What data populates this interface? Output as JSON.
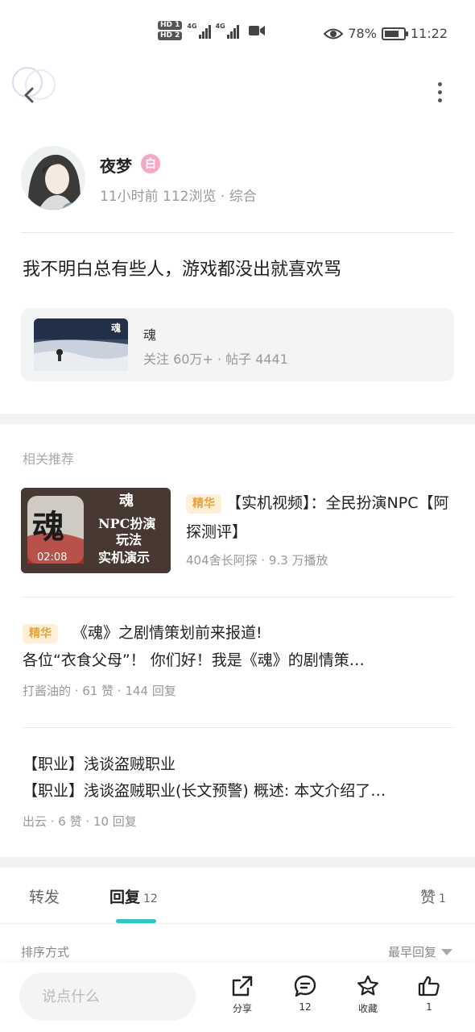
{
  "status_bar": {
    "hd1": "HD 1",
    "hd2": "HD 2",
    "net1": "4G",
    "net2": "4G",
    "battery_pct": "78%",
    "battery_level": 0.78,
    "time": "11:22",
    "icons": [
      "eye-icon",
      "battery-icon",
      "video-camera-icon"
    ]
  },
  "author": {
    "name": "夜梦",
    "level": "白",
    "meta": "11小时前  112浏览 · 综合"
  },
  "post": {
    "text": "我不明白总有些人，游戏都没出就喜欢骂"
  },
  "community": {
    "name": "魂",
    "stats": "关注 60万+ · 帖子 4441",
    "thumb_logo": "魂"
  },
  "related": {
    "title": "相关推荐",
    "items": [
      {
        "tag": "精华",
        "title": "【实机视频】：全民扮演NPC【阿探测评】",
        "meta": "404舍长阿探 · 9.3 万播放",
        "duration": "02:08",
        "thumb_big": "魂",
        "thumb_small": "魂",
        "thumb_line1": "NPC扮演",
        "thumb_line2": "玩法",
        "thumb_line3": "实机演示"
      },
      {
        "tag": "精华",
        "title": "《魂》之剧情策划前来报道!",
        "body": "各位“衣食父母”！ 你们好！我是《魂》的剧情策…",
        "meta": "打酱油的 · 61 赞 · 144 回复"
      },
      {
        "title": "【职业】浅谈盗贼职业",
        "body": "【职业】浅谈盗贼职业(长文预警) 概述: 本文介绍了…",
        "meta": "出云 · 6 赞 · 10 回复"
      }
    ]
  },
  "tabs": {
    "repost": "转发",
    "reply": "回复",
    "reply_count": "12",
    "like": "赞",
    "like_count": "1"
  },
  "sort": {
    "label": "排序方式",
    "value": "最早回复"
  },
  "bottom": {
    "placeholder": "说点什么",
    "share": "分享",
    "comments": "12",
    "favorite": "收藏",
    "likes": "1"
  },
  "colors": {
    "accent": "#2ec4c1",
    "tag_bg": "#fdf0d7",
    "tag_fg": "#e6a23c",
    "level_badge": "#f4a7c6"
  }
}
